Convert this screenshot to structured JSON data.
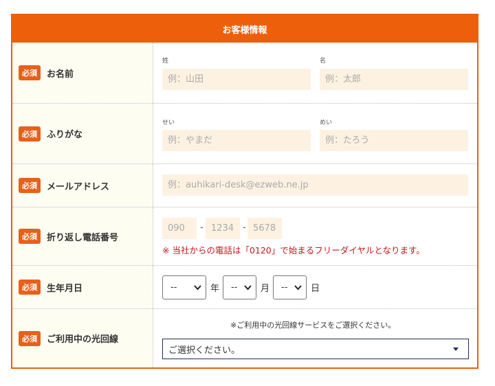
{
  "header": {
    "title": "お客様情報"
  },
  "required_badge": "必須",
  "rows": {
    "name": {
      "label": "お名前",
      "last": {
        "caption": "姓",
        "placeholder": "例：山田"
      },
      "first": {
        "caption": "名",
        "placeholder": "例：太郎"
      }
    },
    "furigana": {
      "label": "ふりがな",
      "last": {
        "caption": "せい",
        "placeholder": "例：やまだ"
      },
      "first": {
        "caption": "めい",
        "placeholder": "例：たろう"
      }
    },
    "email": {
      "label": "メールアドレス",
      "placeholder": "例：auhikari-desk@ezweb.ne.jp"
    },
    "phone": {
      "label": "折り返し電話番号",
      "part1_placeholder": "090",
      "part2_placeholder": "1234",
      "part3_placeholder": "5678",
      "separator": "-",
      "note": "※ 当社からの電話は「0120」で始まるフリーダイヤルとなります。"
    },
    "birthday": {
      "label": "生年月日",
      "year_value": "--",
      "year_unit": "年",
      "month_value": "--",
      "month_unit": "月",
      "day_value": "--",
      "day_unit": "日"
    },
    "line": {
      "label": "ご利用中の光回線",
      "hint": "※ご利用中の光回線サービスをご選択ください。",
      "select_value": "ご選択ください。"
    }
  },
  "colors": {
    "accent": "#ee5f0c",
    "badge": "#e9601a",
    "input_bg": "#fdf2e2",
    "label_bg": "#fdfdf1",
    "note_red": "#c3151c",
    "select_border": "#1e2a5a"
  }
}
